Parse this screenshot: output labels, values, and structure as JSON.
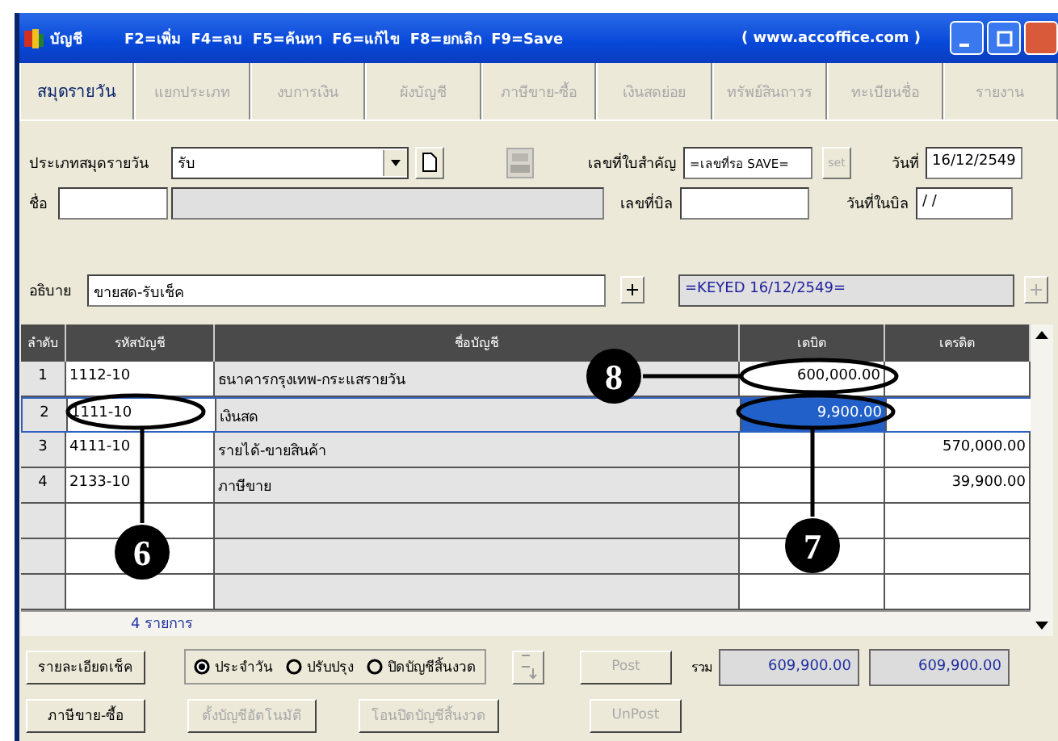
{
  "window": {
    "app_title": "บัญชี",
    "shortcuts": "F2=เพิ่ม  F4=ลบ  F5=ค้นหา  F6=แก้ไข  F8=ยกเลิก  F9=Save",
    "website": "( www.accoffice.com )"
  },
  "tabs": [
    {
      "label": "สมุดรายวัน",
      "selected": true
    },
    {
      "label": "แยกประเภท",
      "selected": false
    },
    {
      "label": "งบการเงิน",
      "selected": false
    },
    {
      "label": "ผังบัญชี",
      "selected": false
    },
    {
      "label": "ภาษีขาย-ซื้อ",
      "selected": false
    },
    {
      "label": "เงินสดย่อย",
      "selected": false
    },
    {
      "label": "ทรัพย์สินถาวร",
      "selected": false
    },
    {
      "label": "ทะเบียนชื่อ",
      "selected": false
    },
    {
      "label": "รายงาน",
      "selected": false
    }
  ],
  "form": {
    "journal_type": {
      "label": "ประเภทสมุดรายวัน",
      "value": "รับ"
    },
    "voucher_no": {
      "label": "เลขที่ใบสำคัญ",
      "value": "=เลขที่รอ SAVE="
    },
    "set_button": {
      "label": "set",
      "disabled": true
    },
    "date": {
      "label": "วันที่",
      "value": "16/12/2549"
    },
    "name": {
      "label": "ชื่อ"
    },
    "bill_no": {
      "label": "เลขที่บิล"
    },
    "bill_date": {
      "label": "วันที่ในบิล",
      "value": "/ /"
    },
    "description": {
      "label": "อธิบาย",
      "value": "ขายสด-รับเช็ค"
    },
    "keyed": "=KEYED 16/12/2549=",
    "keyed_add_disabled": true
  },
  "table": {
    "columns": [
      "ลำดับ",
      "รหัสบัญชี",
      "ชื่อบัญชี",
      "เดบิต",
      "เครดิต"
    ],
    "rows": [
      {
        "no": "1",
        "code": "1112-10",
        "name": "ธนาคารกรุงเทพ-กระแสรายวัน",
        "debit": "600,000.00",
        "credit": "",
        "selected": false
      },
      {
        "no": "2",
        "code": "1111-10",
        "name": "เงินสด",
        "debit": "9,900.00",
        "credit": "",
        "selected": true
      },
      {
        "no": "3",
        "code": "4111-10",
        "name": "รายได้-ขายสินค้า",
        "debit": "",
        "credit": "570,000.00",
        "selected": false
      },
      {
        "no": "4",
        "code": "2133-10",
        "name": "ภาษีขาย",
        "debit": "",
        "credit": "39,900.00",
        "selected": false
      }
    ],
    "count": "4 รายการ"
  },
  "radios": [
    {
      "label": "ประจำวัน",
      "selected": true
    },
    {
      "label": "ปรับปรุง",
      "selected": false
    },
    {
      "label": "ปิดบัญชีสิ้นงวด",
      "selected": false
    }
  ],
  "buttons": [
    {
      "label": "รายละเอียดเช็ค",
      "disabled": false
    },
    {
      "label": "Post",
      "disabled": true
    },
    {
      "label": "ภาษีขาย-ซื้อ",
      "disabled": false
    },
    {
      "label": "ตั้งบัญชีอัตโนมัติ",
      "disabled": true
    },
    {
      "label": "โอนปิดบัญชีสิ้นงวด",
      "disabled": true
    },
    {
      "label": "UnPost",
      "disabled": true
    }
  ],
  "totals": {
    "label": "รวม",
    "debit": "609,900.00",
    "credit": "609,900.00"
  },
  "callouts": [
    {
      "number": "8"
    },
    {
      "number": "6"
    },
    {
      "number": "7"
    }
  ]
}
